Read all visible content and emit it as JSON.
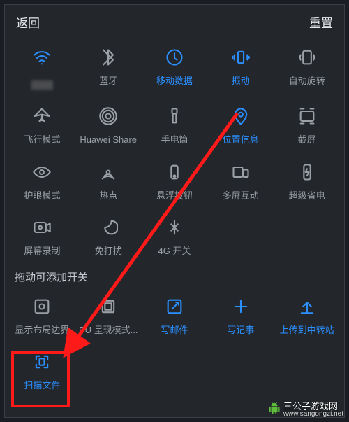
{
  "header": {
    "back": "返回",
    "reset": "重置"
  },
  "tiles_main": [
    {
      "key": "wifi",
      "label": "",
      "wifi_name": "████",
      "active": true
    },
    {
      "key": "bluetooth",
      "label": "蓝牙",
      "active": false
    },
    {
      "key": "mobile-data",
      "label": "移动数据",
      "active": true
    },
    {
      "key": "vibrate",
      "label": "振动",
      "active": true
    },
    {
      "key": "auto-rotate",
      "label": "自动旋转",
      "active": false
    },
    {
      "key": "airplane",
      "label": "飞行模式",
      "active": false
    },
    {
      "key": "huawei-share",
      "label": "Huawei Share",
      "active": false
    },
    {
      "key": "flashlight",
      "label": "手电筒",
      "active": false
    },
    {
      "key": "location",
      "label": "位置信息",
      "active": true
    },
    {
      "key": "screenshot",
      "label": "截屏",
      "active": false
    },
    {
      "key": "eye-comfort",
      "label": "护眼模式",
      "active": false
    },
    {
      "key": "hotspot",
      "label": "热点",
      "active": false
    },
    {
      "key": "floating-button",
      "label": "悬浮按钮",
      "active": false
    },
    {
      "key": "multi-screen",
      "label": "多屏互动",
      "active": false
    },
    {
      "key": "ultra-power-save",
      "label": "超级省电",
      "active": false
    },
    {
      "key": "screen-record",
      "label": "屏幕录制",
      "active": false
    },
    {
      "key": "dnd",
      "label": "免打扰",
      "active": false
    },
    {
      "key": "4g-switch",
      "label": "4G 开关",
      "active": false
    }
  ],
  "drag_hint": "拖动可添加开关",
  "tiles_extra": [
    {
      "key": "show-layout",
      "label": "显示布局边界",
      "active": false
    },
    {
      "key": "gpu-render",
      "label": "PU 呈现模式...",
      "active": false
    },
    {
      "key": "compose-mail",
      "label": "写邮件",
      "active": true
    },
    {
      "key": "compose-note",
      "label": "写记事",
      "active": true
    },
    {
      "key": "upload-transfer",
      "label": "上传到中转站",
      "active": true
    },
    {
      "key": "scan-file",
      "label": "扫描文件",
      "active": true
    }
  ],
  "highlight": {
    "target": "scan-file"
  },
  "watermark": {
    "text": "三公子游戏网",
    "url": "www.sangongzi.net"
  }
}
